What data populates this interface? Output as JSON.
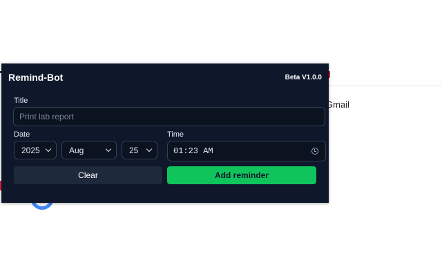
{
  "background": {
    "gmail_link": "Gmail"
  },
  "popup": {
    "title": "Remind-Bot",
    "version": "Beta V1.0.0",
    "form": {
      "title_label": "Title",
      "title_placeholder": "Print lab report",
      "title_value": "",
      "date_label": "Date",
      "year": "2025",
      "month": "Aug",
      "day": "25",
      "time_label": "Time",
      "time_value": "01:23 AM"
    },
    "buttons": {
      "clear": "Clear",
      "add": "Add reminder"
    }
  },
  "colors": {
    "panel_bg": "#0f172a",
    "field_bg": "#0b1220",
    "accent_green": "#10c45c",
    "clear_bg": "#1e293b"
  },
  "icons": {
    "select_arrow": "chevron-down-icon",
    "time_picker": "clock-icon"
  }
}
